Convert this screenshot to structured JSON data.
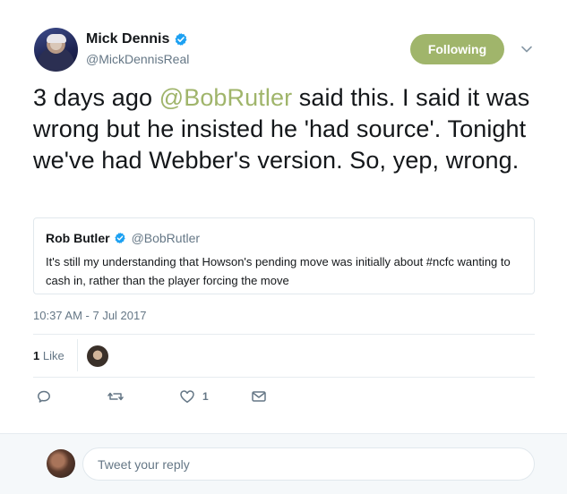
{
  "author": {
    "display_name": "Mick Dennis",
    "handle": "@MickDennisReal",
    "verified": true
  },
  "follow_button": {
    "label": "Following"
  },
  "tweet": {
    "text_before_mention": "3 days ago ",
    "mention": "@BobRutler",
    "text_after_mention": " said this. I said it was wrong but he insisted he 'had source'. Tonight we've had Webber's version. So, yep, wrong.",
    "timestamp": "10:37 AM - 7 Jul 2017"
  },
  "quoted_tweet": {
    "display_name": "Rob Butler",
    "handle": "@BobRutler",
    "verified": true,
    "text": "It's still my understanding that Howson's pending move was initially about #ncfc wanting to cash in, rather than the player forcing the move"
  },
  "engagement": {
    "like_count": "1",
    "like_label": "Like"
  },
  "actions": {
    "reply_icon": "reply-icon",
    "retweet_icon": "retweet-icon",
    "like_icon": "heart-icon",
    "like_count": "1",
    "message_icon": "envelope-icon"
  },
  "reply_box": {
    "placeholder": "Tweet your reply"
  },
  "colors": {
    "accent": "#a0b56b",
    "verified": "#1da1f2",
    "secondary_text": "#657786"
  }
}
